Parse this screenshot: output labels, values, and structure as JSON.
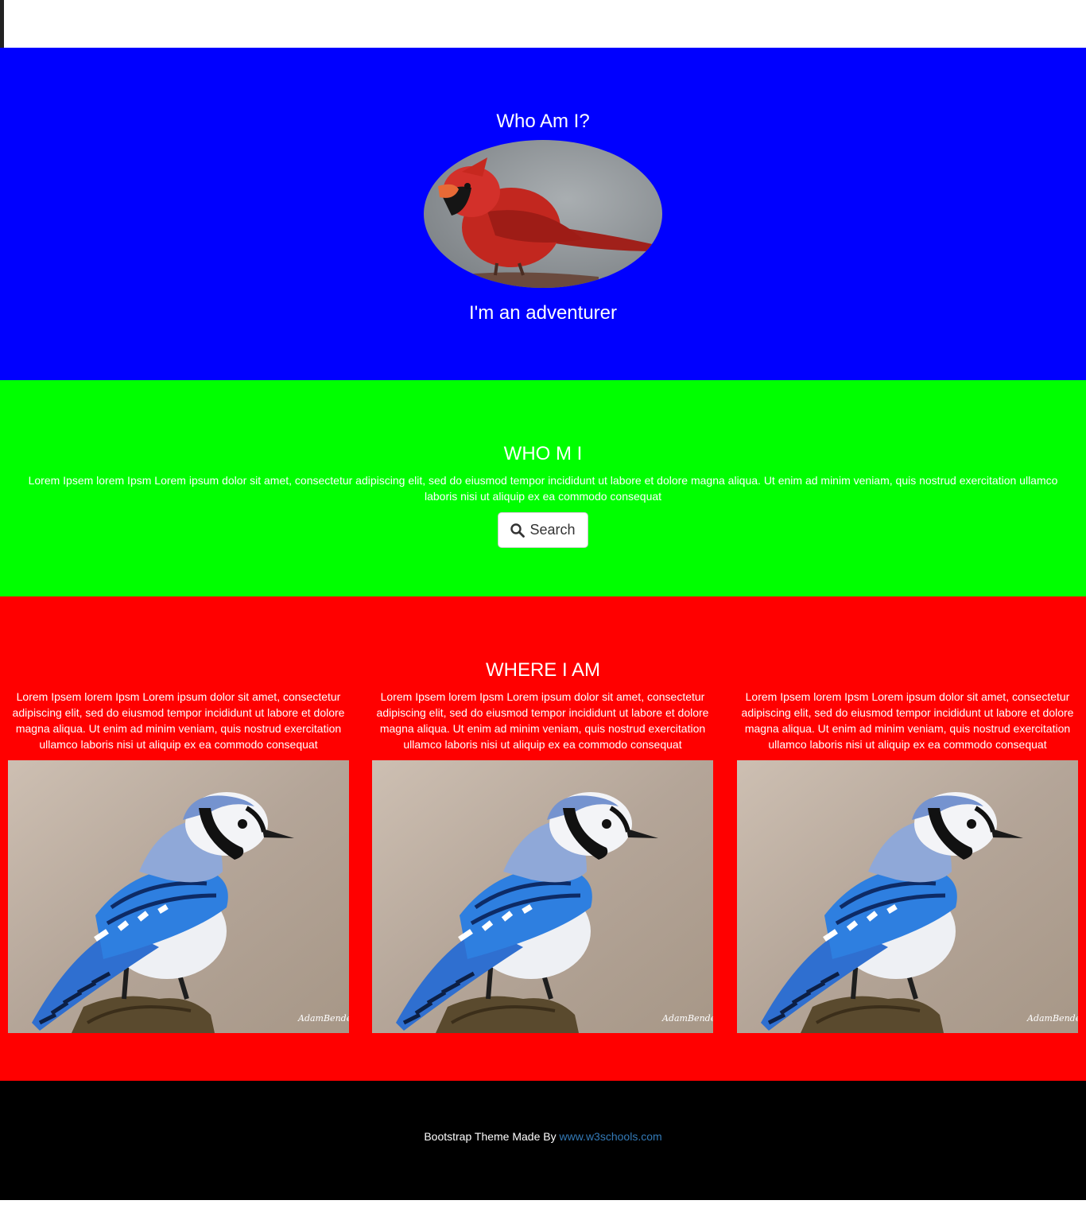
{
  "colors": {
    "hero_bg": "#0000ff",
    "about_bg": "#00ff00",
    "where_bg": "#ff0000",
    "footer_bg": "#000000",
    "text": "#ffffff",
    "link": "#337ab7"
  },
  "hero": {
    "title": "Who Am I?",
    "avatar_icon": "cardinal-bird-photo",
    "tagline": "I'm an adventurer"
  },
  "about": {
    "title": "WHO M I",
    "text": "Lorem Ipsem lorem Ipsm Lorem ipsum dolor sit amet, consectetur adipiscing elit, sed do eiusmod tempor incididunt ut labore et dolore magna aliqua. Ut enim ad minim veniam, quis nostrud exercitation ullamco laboris nisi ut aliquip ex ea commodo consequat",
    "search_button_label": "Search",
    "search_icon": "search-icon"
  },
  "where": {
    "title": "WHERE I AM",
    "columns": [
      {
        "text": "Lorem Ipsem lorem Ipsm Lorem ipsum dolor sit amet, consectetur adipiscing elit, sed do eiusmod tempor incididunt ut labore et dolore magna aliqua. Ut enim ad minim veniam, quis nostrud exercitation ullamco laboris nisi ut aliquip ex ea commodo consequat",
        "photo_icon": "blue-jay-photo"
      },
      {
        "text": "Lorem Ipsem lorem Ipsm Lorem ipsum dolor sit amet, consectetur adipiscing elit, sed do eiusmod tempor incididunt ut labore et dolore magna aliqua. Ut enim ad minim veniam, quis nostrud exercitation ullamco laboris nisi ut aliquip ex ea commodo consequat",
        "photo_icon": "blue-jay-photo"
      },
      {
        "text": "Lorem Ipsem lorem Ipsm Lorem ipsum dolor sit amet, consectetur adipiscing elit, sed do eiusmod tempor incididunt ut labore et dolore magna aliqua. Ut enim ad minim veniam, quis nostrud exercitation ullamco laboris nisi ut aliquip ex ea commodo consequat",
        "photo_icon": "blue-jay-photo"
      }
    ]
  },
  "footer": {
    "prefix": "Bootstrap Theme Made By ",
    "link_text": "www.w3schools.com"
  }
}
